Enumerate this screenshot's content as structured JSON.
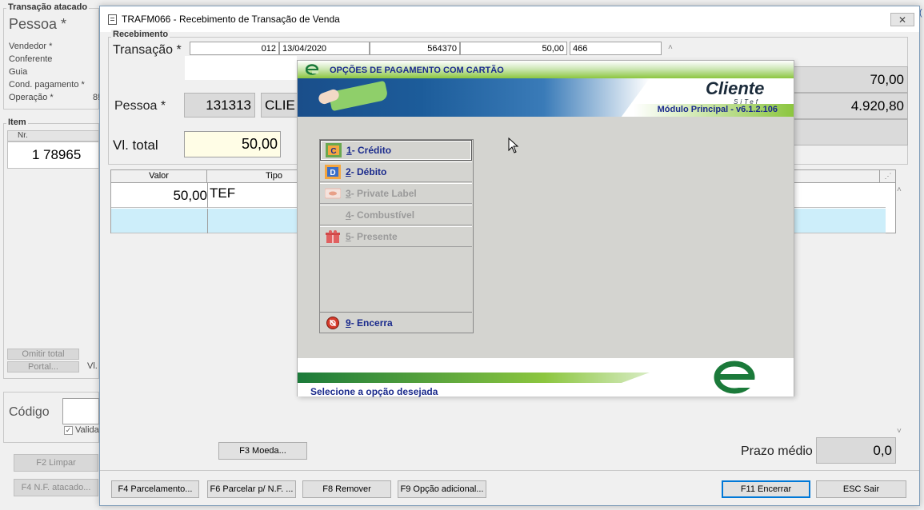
{
  "bg": {
    "group_title": "Transação atacado",
    "pessoa_label": "Pessoa *",
    "fields": [
      "Vendedor *",
      "Conferente",
      "Guia",
      "Cond. pagamento *",
      "Operação *"
    ],
    "operacao_value": "8!",
    "item_title": "Item",
    "item_col_nr": "Nr.",
    "item_row_nr": "1",
    "item_row_code": "78965",
    "omitir_total": "Omitir total",
    "portal": "Portal...",
    "vl_label": "Vl.",
    "codigo_label": "Código",
    "valida_label": "Valida",
    "f2": "F2 Limpar",
    "f4_nf": "F4 N.F. atacado...",
    "right_edge": "("
  },
  "dialog": {
    "title": "TRAFM066 - Recebimento de Transação de Venda",
    "section": "Recebimento",
    "transacao_label": "Transação *",
    "transacao_fields": [
      "012",
      "13/04/2020",
      "564370",
      "50,00",
      "466"
    ],
    "pessoa_label": "Pessoa *",
    "pessoa_code": "131313",
    "pessoa_name": "CLIE",
    "vl_total_label": "Vl. total",
    "vl_total_value": "50,00",
    "right_values": [
      "70,00",
      "4.920,80"
    ],
    "grid_headers": [
      "Valor",
      "Tipo"
    ],
    "grid_rows": [
      {
        "valor": "50,00",
        "tipo": "TEF"
      }
    ],
    "f3_moeda": "F3 Moeda...",
    "prazo_label": "Prazo médio",
    "prazo_value": "0,0",
    "buttons": [
      "F4 Parcelamento...",
      "F6 Parcelar p/ N.F. ...",
      "F8 Remover",
      "F9 Opção adicional...",
      "F11 Encerrar",
      "ESC Sair"
    ]
  },
  "popup": {
    "title": "OPÇÕES DE PAGAMENTO COM CARTÃO",
    "brand": "Cliente",
    "brand_sub": "SiTef",
    "module": "Módulo Principal - v6.1.2.106",
    "options": [
      {
        "key": "1",
        "label": " - Crédito",
        "enabled": true,
        "icon": "credit-card-icon"
      },
      {
        "key": "2",
        "label": " - Débito",
        "enabled": true,
        "icon": "debit-card-icon"
      },
      {
        "key": "3",
        "label": " - Private Label",
        "enabled": false,
        "icon": "private-label-icon"
      },
      {
        "key": "4",
        "label": " - Combustível",
        "enabled": false,
        "icon": ""
      },
      {
        "key": "5",
        "label": " - Presente",
        "enabled": false,
        "icon": "gift-icon"
      }
    ],
    "close": {
      "key": "9",
      "label": " - Encerra"
    },
    "status": "Selecione a opção desejada"
  }
}
